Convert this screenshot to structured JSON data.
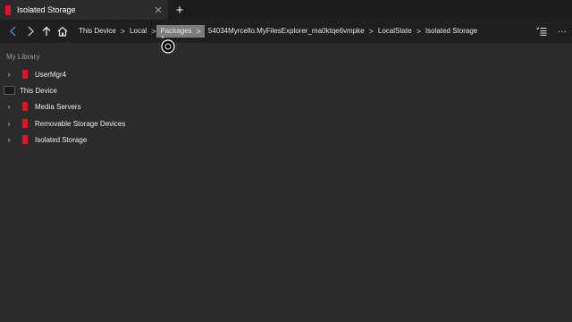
{
  "tab": {
    "title": "Isolated Storage",
    "close_glyph": "✕",
    "accent": "#e81123"
  },
  "new_tab_glyph": "+",
  "nav": {
    "back_icon": "chevron-left-icon",
    "forward_icon": "chevron-right-icon",
    "up_icon": "arrow-up-icon",
    "home_icon": "home-icon",
    "back_color": "#3d8ee6"
  },
  "breadcrumb": {
    "separator": ">",
    "items": [
      "This Device",
      "Local",
      "Packages",
      "54034Myrcello.MyFilesExplorer_ma0ktqe6vmpke",
      "LocalState",
      "Isolated Storage"
    ]
  },
  "toolbar": {
    "view_icon": "list-view-icon",
    "more_glyph": "···"
  },
  "library": {
    "header": "My Library",
    "items": [
      {
        "label": "UserMgr4",
        "expandable": true,
        "icon": "red-folder-icon"
      },
      {
        "label": "This Device",
        "expandable": false,
        "icon": "drive-icon"
      },
      {
        "label": "Media Servers",
        "expandable": true,
        "icon": "red-folder-icon"
      },
      {
        "label": "Removable Storage Devices",
        "expandable": true,
        "icon": "red-folder-icon"
      },
      {
        "label": "Isolated Storage",
        "expandable": true,
        "icon": "red-folder-icon"
      }
    ]
  }
}
